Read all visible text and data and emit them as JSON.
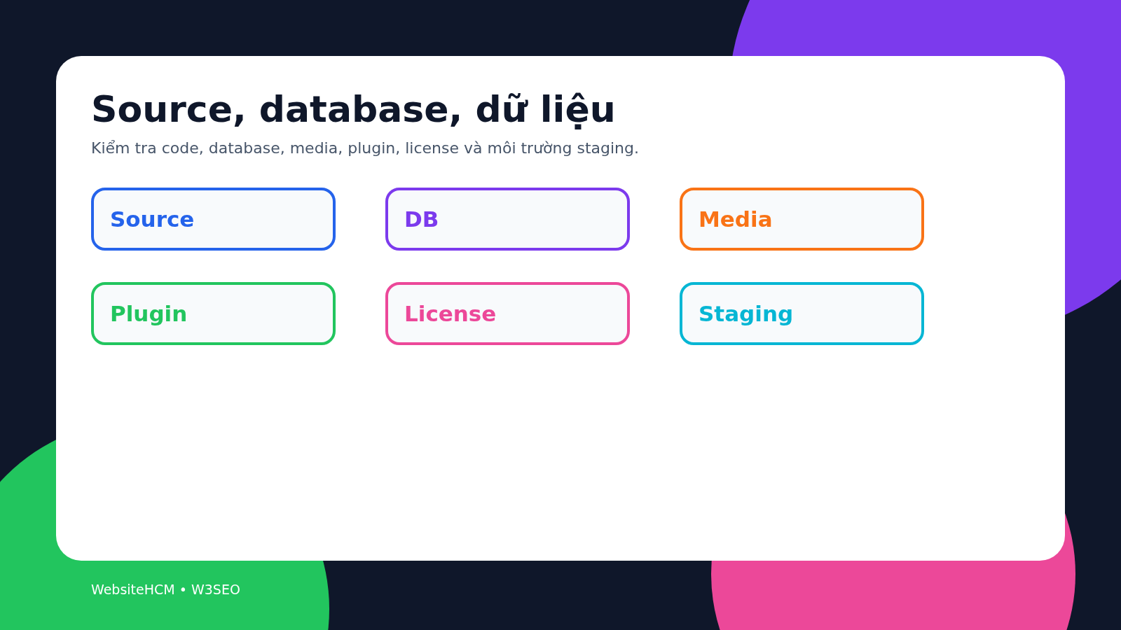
{
  "title": "Source, database, dữ liệu",
  "subtitle": "Kiểm tra code, database, media, plugin, license và môi trường staging.",
  "items": [
    {
      "label": "Source",
      "color": "#2563eb"
    },
    {
      "label": "DB",
      "color": "#7c3aed"
    },
    {
      "label": "Media",
      "color": "#f97316"
    },
    {
      "label": "Plugin",
      "color": "#22c55e"
    },
    {
      "label": "License",
      "color": "#ec4899"
    },
    {
      "label": "Staging",
      "color": "#06b6d4"
    }
  ],
  "footer": "WebsiteHCM • W3SEO"
}
